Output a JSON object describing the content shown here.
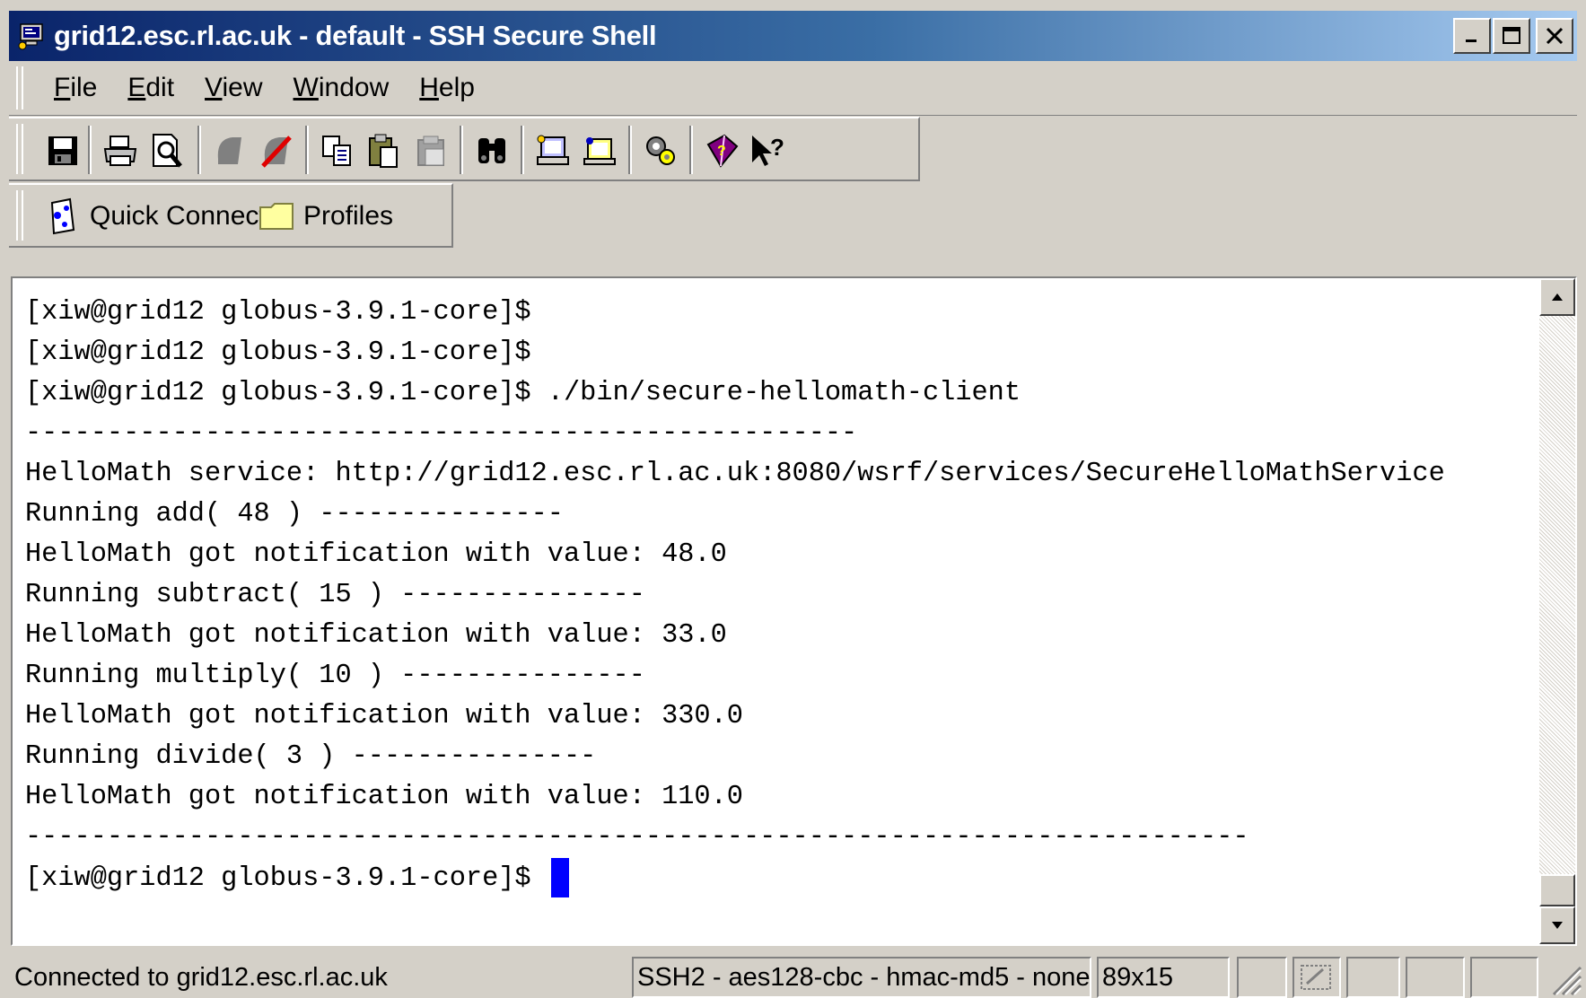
{
  "window": {
    "title": "grid12.esc.rl.ac.uk - default - SSH Secure Shell",
    "caption_buttons": {
      "minimize": "_",
      "maximize": "□",
      "close": "X"
    }
  },
  "menu": {
    "items": [
      {
        "label": "File",
        "accesskey": "F"
      },
      {
        "label": "Edit",
        "accesskey": "E"
      },
      {
        "label": "View",
        "accesskey": "V"
      },
      {
        "label": "Window",
        "accesskey": "W"
      },
      {
        "label": "Help",
        "accesskey": "H"
      }
    ]
  },
  "toolbar": {
    "icons": [
      "save-icon",
      "print-icon",
      "print-preview-icon",
      "new-terminal-icon",
      "disconnect-icon",
      "copy-icon",
      "paste-icon",
      "paste-disabled-icon",
      "find-icon",
      "new-file-transfer-icon",
      "settings-icon",
      "key-icon",
      "help-book-icon",
      "context-help-icon"
    ]
  },
  "quickbar": {
    "quick_connect": "Quick Connect",
    "profiles": "Profiles"
  },
  "terminal": {
    "lines": [
      "[xiw@grid12 globus-3.9.1-core]$",
      "[xiw@grid12 globus-3.9.1-core]$",
      "[xiw@grid12 globus-3.9.1-core]$ ./bin/secure-hellomath-client",
      "---------------------------------------------------",
      "HelloMath service: http://grid12.esc.rl.ac.uk:8080/wsrf/services/SecureHelloMathService",
      "Running add( 48 ) ---------------",
      "HelloMath got notification with value: 48.0",
      "Running subtract( 15 ) ---------------",
      "HelloMath got notification with value: 33.0",
      "Running multiply( 10 ) ---------------",
      "HelloMath got notification with value: 330.0",
      "Running divide( 3 ) ---------------",
      "HelloMath got notification with value: 110.0",
      "---------------------------------------------------------------------------",
      "[xiw@grid12 globus-3.9.1-core]$ "
    ],
    "cursor_color": "#0000ff"
  },
  "status": {
    "connection": "Connected to grid12.esc.rl.ac.uk",
    "cipher": "SSH2 - aes128-cbc - hmac-md5 - none",
    "size": "89x15"
  },
  "colors": {
    "titlebar_start": "#0a246a",
    "titlebar_end": "#a6caf0",
    "chrome": "#d4d0c8"
  }
}
